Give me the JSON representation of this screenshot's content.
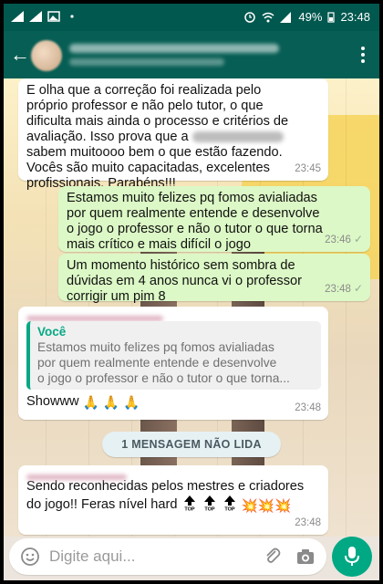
{
  "status_bar": {
    "battery": "49%",
    "time": "23:48"
  },
  "messages": [
    {
      "type": "in",
      "text_line1": "E olha que a correção foi realizada pelo",
      "text_line2": "próprio professor e não pelo tutor, o que",
      "text_line3": "dificulta mais ainda o processo e critérios de",
      "text_line4": "avaliação. Isso prova que a",
      "text_line5": "sabem muitoooo bem o que estão fazendo.",
      "text_line6": "Vocês são muito capacitadas, excelentes",
      "text_line7": "profissionais. Parabéns!!!",
      "time": "23:45"
    },
    {
      "type": "out",
      "text_line1": "Estamos muito felizes pq fomos avialiadas",
      "text_line2": "por quem realmente entende e desenvolve",
      "text_line3": "o jogo o professor e não o tutor o que torna",
      "text_line4": "mais crítico e mais difícil o jogo",
      "time": "23:46"
    },
    {
      "type": "out",
      "text_line1": "Um momento histórico sem sombra de",
      "text_line2": "dúvidas em 4 anos nunca vi o professor",
      "text_line3": "corrigir um pim 8",
      "time": "23:48"
    },
    {
      "type": "in",
      "quote_author": "Você",
      "quote_line1": "Estamos muito felizes pq fomos avialiadas",
      "quote_line2": "por quem realmente entende e desenvolve",
      "quote_line3": "o jogo o professor e não o tutor o que torna...",
      "text": "Showww",
      "time": "23:48"
    },
    {
      "type": "in",
      "text_line1": "Sendo reconhecidas pelos mestres e criadores",
      "text_line2": "do jogo!! Feras nível hard",
      "time": "23:48"
    }
  ],
  "unread_banner": "1 MENSAGEM NÃO LIDA",
  "input": {
    "placeholder": "Digite aqui..."
  },
  "icons": {
    "back": "back-arrow-icon",
    "menu": "more-vert-icon",
    "emoji": "emoji-icon",
    "attach": "paperclip-icon",
    "camera": "camera-icon",
    "mic": "microphone-icon"
  },
  "colors": {
    "app_bar": "#075e54",
    "outgoing_bubble": "#dcf8c6",
    "incoming_bubble": "#ffffff",
    "accent": "#00a884"
  }
}
